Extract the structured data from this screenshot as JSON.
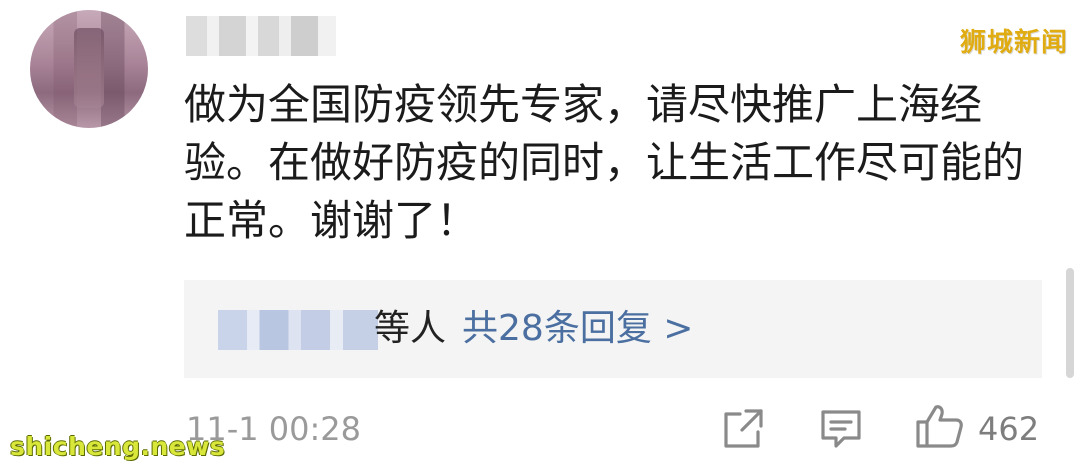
{
  "watermark": {
    "top": "狮城新闻",
    "bottom": "shicheng.news"
  },
  "comment": {
    "body": "做为全国防疫领先专家，请尽快推广上海经验。在做好防疫的同时，让生活工作尽可能的正常。谢谢了！",
    "timestamp": "11-1 00:28",
    "like_count": "462"
  },
  "replies": {
    "prefix": "等人",
    "link_label": "共28条回复 >"
  },
  "colors": {
    "link": "#4a6fa0",
    "watermark_top": "#e0ac11",
    "watermark_bottom": "#d9e73a"
  },
  "icons": [
    "share-icon",
    "comment-icon",
    "thumbs-up-icon"
  ]
}
